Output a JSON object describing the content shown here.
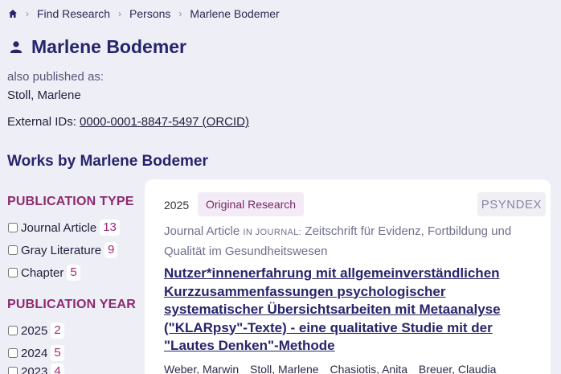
{
  "breadcrumb": {
    "items": [
      "Find Research",
      "Persons",
      "Marlene Bodemer"
    ]
  },
  "person": {
    "name": "Marlene Bodemer",
    "also_label": "also published as:",
    "alias": "Stoll, Marlene",
    "ext_label": "External IDs:",
    "ext_id": "0000-0001-8847-5497 (ORCID)"
  },
  "works_title": "Works by Marlene Bodemer",
  "facets": {
    "type_title": "PUBLICATION TYPE",
    "types": [
      {
        "label": "Journal Article",
        "count": "13"
      },
      {
        "label": "Gray Literature",
        "count": "9"
      },
      {
        "label": "Chapter",
        "count": "5"
      }
    ],
    "year_title": "PUBLICATION YEAR",
    "years": [
      {
        "label": "2025",
        "count": "2"
      },
      {
        "label": "2024",
        "count": "5"
      },
      {
        "label": "2023",
        "count": "4"
      }
    ]
  },
  "work": {
    "year": "2025",
    "badge": "Original Research",
    "source": "PSYNDEX",
    "type": "Journal Article",
    "in_journal": "IN JOURNAL:",
    "journal": "Zeitschrift für Evidenz, Fortbildung und Qualität im Gesundheitswesen",
    "title": "Nutzer*innenerfahrung mit allgemeinverständlichen Kurzzusammenfassungen psychologischer systematischer Übersichtsarbeiten mit Metaanalyse (\"KLARpsy\"-Texte) - eine qualitative Studie mit der \"Lautes Denken\"-Methode",
    "authors": [
      "Weber, Marwin",
      "Stoll, Marlene",
      "Chasiotis, Anita",
      "Breuer, Claudia"
    ]
  },
  "colors": {
    "background": "#eeeef6",
    "heading": "#27246b",
    "facet_title": "#8e2a6e",
    "count": "#a0287a"
  }
}
